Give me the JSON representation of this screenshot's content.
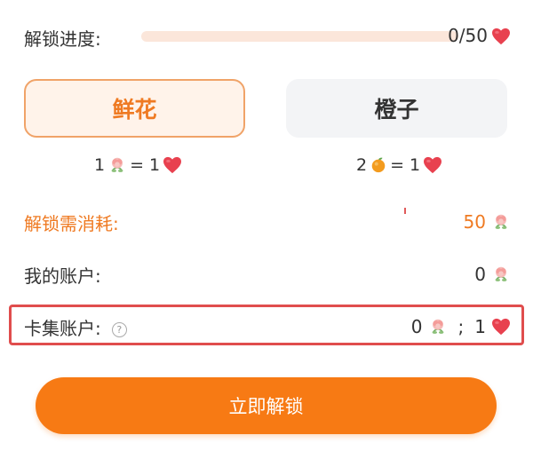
{
  "progress": {
    "label": "解锁进度:",
    "current": 0,
    "total": 50,
    "value_text": "0/50",
    "fraction": 0.0
  },
  "tabs": [
    {
      "label": "鲜花",
      "selected": true
    },
    {
      "label": "橙子",
      "selected": false
    }
  ],
  "rates": {
    "flowers": {
      "left_num": "1",
      "right_num": "= 1"
    },
    "oranges": {
      "left_num": "2",
      "right_num": "= 1"
    }
  },
  "cost": {
    "label": "解锁需消耗:",
    "value": "50"
  },
  "my_account": {
    "label": "我的账户:",
    "value": "0"
  },
  "card_account": {
    "label": "卡集账户:",
    "help": "?",
    "flowers": "0",
    "separator": ";",
    "hearts": "1"
  },
  "unlock_button": {
    "label": "立即解锁"
  },
  "colors": {
    "accent": "#f77a14",
    "accent_text": "#ef7a22",
    "highlight": "#e04d4d",
    "heart": "#e8414f"
  },
  "icons": {
    "heart": "heart-icon",
    "flower": "flower-icon",
    "orange": "orange-icon",
    "help": "help-icon"
  }
}
